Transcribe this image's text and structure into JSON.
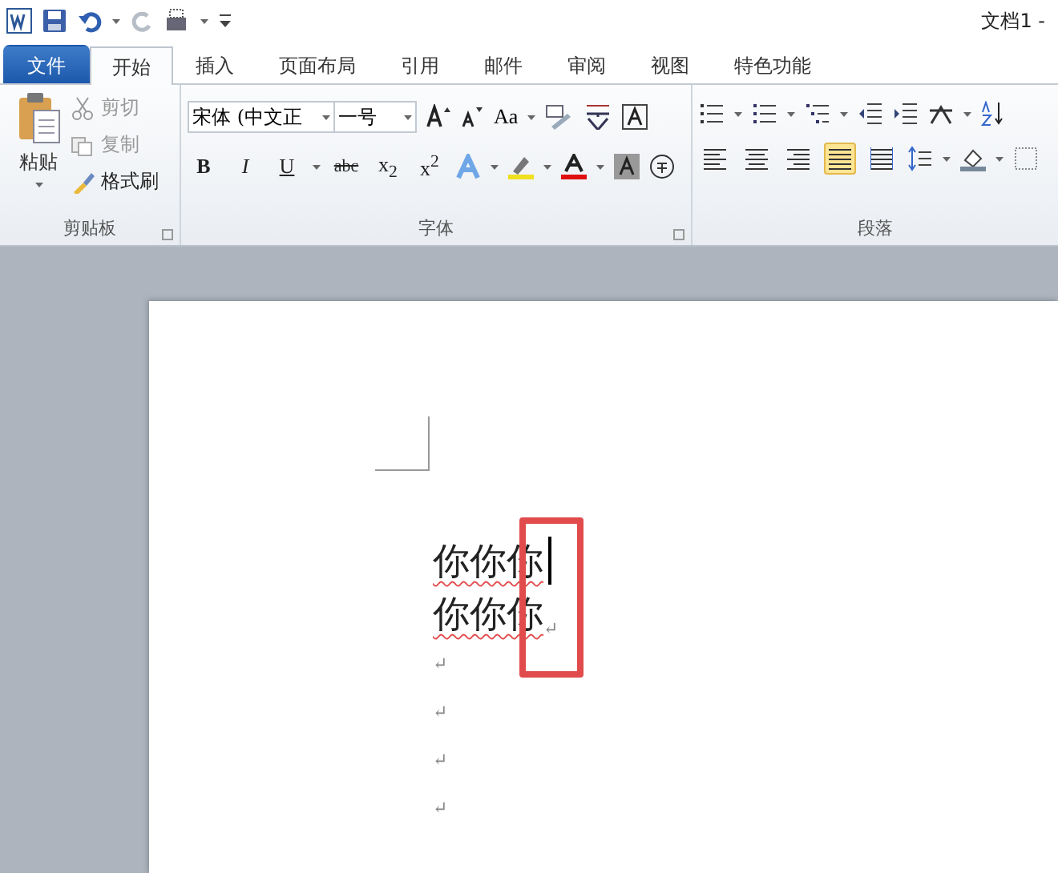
{
  "title_bar": {
    "title": "文档1 -"
  },
  "tabs": [
    {
      "label": "文件",
      "kind": "file",
      "selected": false
    },
    {
      "label": "开始",
      "kind": "tab",
      "selected": true
    },
    {
      "label": "插入",
      "kind": "tab",
      "selected": false
    },
    {
      "label": "页面布局",
      "kind": "tab",
      "selected": false
    },
    {
      "label": "引用",
      "kind": "tab",
      "selected": false
    },
    {
      "label": "邮件",
      "kind": "tab",
      "selected": false
    },
    {
      "label": "审阅",
      "kind": "tab",
      "selected": false
    },
    {
      "label": "视图",
      "kind": "tab",
      "selected": false
    },
    {
      "label": "特色功能",
      "kind": "tab",
      "selected": false
    }
  ],
  "clipboard": {
    "paste": "粘贴",
    "group_label": "剪贴板",
    "items": [
      {
        "label": "剪切",
        "disabled": true
      },
      {
        "label": "复制",
        "disabled": true
      },
      {
        "label": "格式刷",
        "disabled": false
      }
    ]
  },
  "font": {
    "font_name": "宋体 (中文正",
    "font_size": "一号",
    "case_button": "Aa",
    "group_label": "字体",
    "format_buttons": [
      "B",
      "I",
      "U",
      "abc",
      "x$_{2}$",
      "x$^{2}$"
    ]
  },
  "paragraph": {
    "group_label": "段落",
    "alignment": [
      {
        "kind": "left",
        "selected": false
      },
      {
        "kind": "center",
        "selected": false
      },
      {
        "kind": "right",
        "selected": false
      },
      {
        "kind": "justify",
        "selected": true
      },
      {
        "kind": "distributed",
        "selected": false
      }
    ]
  },
  "document": {
    "lines": [
      {
        "text": "你你你",
        "cursor": true
      },
      {
        "text": "你你你",
        "cursor": false,
        "mark": "↵"
      }
    ],
    "empty_paragraphs": [
      "↵",
      "↵",
      "↵",
      "↵"
    ]
  }
}
